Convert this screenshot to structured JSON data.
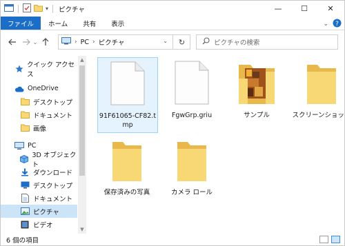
{
  "window": {
    "title": "ピクチャ",
    "controls": {
      "minimize": "—",
      "maximize": "☐",
      "close": "✕"
    }
  },
  "ribbon": {
    "tabs": [
      "ファイル",
      "ホーム",
      "共有",
      "表示"
    ]
  },
  "nav": {
    "breadcrumb": [
      "PC",
      "ピクチャ"
    ],
    "search_placeholder": "ピクチャの検索"
  },
  "sidebar": {
    "items": [
      {
        "label": "クイック アクセス",
        "icon": "star-icon"
      },
      {
        "label": "OneDrive",
        "icon": "cloud-icon"
      },
      {
        "label": "デスクトップ",
        "icon": "folder-icon"
      },
      {
        "label": "ドキュメント",
        "icon": "folder-icon"
      },
      {
        "label": "画像",
        "icon": "folder-icon"
      },
      {
        "label": "PC",
        "icon": "pc-icon"
      },
      {
        "label": "3D オブジェクト",
        "icon": "cube-icon"
      },
      {
        "label": "ダウンロード",
        "icon": "download-icon"
      },
      {
        "label": "デスクトップ",
        "icon": "desktop-icon"
      },
      {
        "label": "ドキュメント",
        "icon": "document-icon"
      },
      {
        "label": "ピクチャ",
        "icon": "pictures-icon"
      },
      {
        "label": "ビデオ",
        "icon": "video-icon"
      }
    ]
  },
  "content": {
    "items": [
      {
        "name": "91F61065-CF82.tmp",
        "type": "file"
      },
      {
        "name": "FgwGrp.griu",
        "type": "file"
      },
      {
        "name": "サンプル",
        "type": "photo-folder"
      },
      {
        "name": "スクリーンショット",
        "type": "folder"
      },
      {
        "name": "保存済みの写真",
        "type": "folder"
      },
      {
        "name": "カメラ ロール",
        "type": "folder"
      }
    ]
  },
  "status": {
    "count": "6 個の項目"
  },
  "colors": {
    "accent": "#1a6ec7",
    "selection": "#cce4f7",
    "folder": "#f8d775",
    "folder_dark": "#e8b94a"
  }
}
